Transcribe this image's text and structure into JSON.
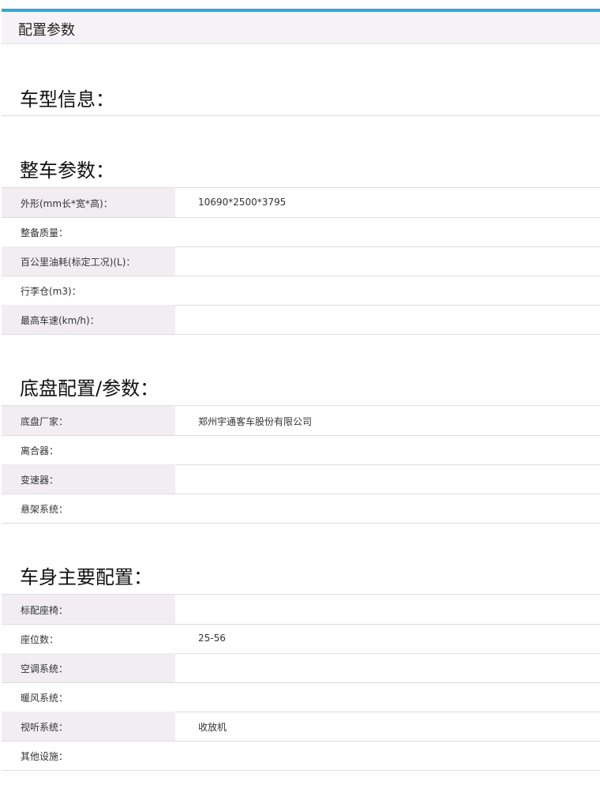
{
  "panel": {
    "title": "配置参数"
  },
  "sections": [
    {
      "title": "车型信息：",
      "rows": []
    },
    {
      "title": "整车参数：",
      "rows": [
        {
          "label": "外形(mm长*宽*高)：",
          "value": "10690*2500*3795"
        },
        {
          "label": "整备质量：",
          "value": ""
        },
        {
          "label": "百公里油耗(标定工况)(L)：",
          "value": ""
        },
        {
          "label": "行李仓(m3)：",
          "value": ""
        },
        {
          "label": "最高车速(km/h)：",
          "value": ""
        }
      ]
    },
    {
      "title": "底盘配置/参数：",
      "rows": [
        {
          "label": "底盘厂家：",
          "value": "郑州宇通客车股份有限公司"
        },
        {
          "label": "离合器：",
          "value": ""
        },
        {
          "label": "变速器：",
          "value": ""
        },
        {
          "label": "悬架系统：",
          "value": ""
        }
      ]
    },
    {
      "title": "车身主要配置：",
      "rows": [
        {
          "label": "标配座椅：",
          "value": ""
        },
        {
          "label": "座位数：",
          "value": "25-56"
        },
        {
          "label": "空调系统：",
          "value": ""
        },
        {
          "label": "暖风系统：",
          "value": ""
        },
        {
          "label": "视听系统：",
          "value": "收放机"
        },
        {
          "label": "其他设施：",
          "value": ""
        }
      ]
    }
  ],
  "colors": {
    "accent": "#2aaad6",
    "header_bg": "#f5f3f7",
    "shaded_label_bg": "#f1edf1",
    "divider": "#dddddd"
  }
}
